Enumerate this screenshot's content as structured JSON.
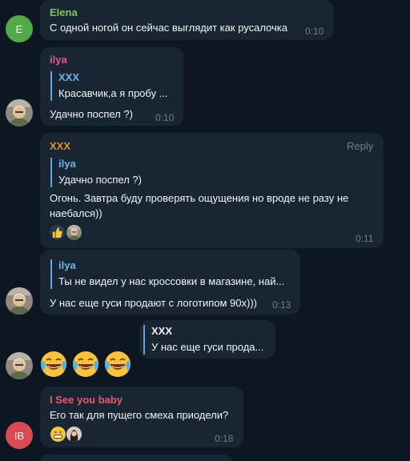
{
  "messages": [
    {
      "sender": "Elena",
      "sender_color": "#7dc45e",
      "avatar_letter": "E",
      "avatar_color": "#52a947",
      "text": "С одной ногой он сейчас выглядит как русалочка",
      "time": "0:10"
    },
    {
      "sender": "ilya",
      "sender_color": "#e55c8a",
      "quote_name": "XXX",
      "quote_text": "Красавчик,а я пробу ...",
      "text": "Удачно поспел ?)",
      "time": "0:10"
    },
    {
      "sender": "XXX",
      "sender_color": "#e8912f",
      "reply_label": "Reply",
      "quote_name": "ilya",
      "quote_text": "Удачно поспел ?)",
      "text_line1": "Огонь. Завтра буду проверять ощущения но вроде не разу не",
      "text_line2": "наебался))",
      "time": "0:11"
    },
    {
      "quote_name": "ilya",
      "quote_text": "Ты не видел у нас кроссовки  в магазине, най...",
      "text": "У нас еще гуси продают с логотипом 90х)))",
      "time": "0:13"
    },
    {
      "quote_name": "XXX",
      "quote_text": "У нас еще гуси прода..."
    },
    {
      "sender": "I See you baby",
      "sender_color": "#e55c70",
      "avatar_letter": "IB",
      "avatar_color": "#d84a52",
      "text": "Его так для пущего смеха приодели?",
      "time": "0:18"
    }
  ],
  "icons": {
    "reactions_msg3": [
      "thumbs-up-icon",
      "avatar-reaction-icon"
    ],
    "big_emojis": [
      "laughing-crying-emoji",
      "laughing-crying-emoji",
      "laughing-crying-emoji"
    ],
    "reactions_msg6": [
      "grinning-emoji-icon",
      "avatar-reaction-icon"
    ]
  }
}
